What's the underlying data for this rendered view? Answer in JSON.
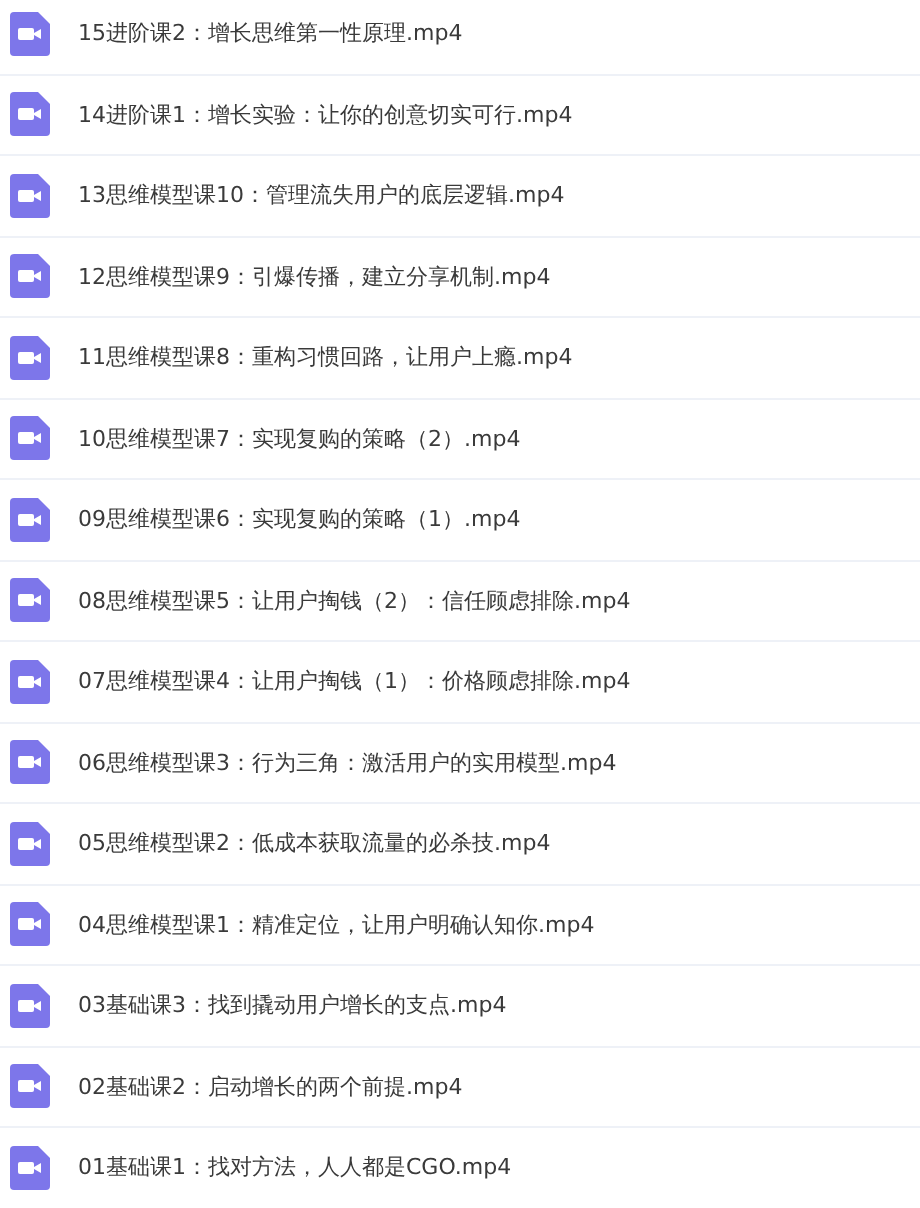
{
  "files": [
    {
      "name": "15进阶课2：增长思维第一性原理.mp4"
    },
    {
      "name": "14进阶课1：增长实验：让你的创意切实可行.mp4"
    },
    {
      "name": "13思维模型课10：管理流失用户的底层逻辑.mp4"
    },
    {
      "name": "12思维模型课9：引爆传播，建立分享机制.mp4"
    },
    {
      "name": "11思维模型课8：重构习惯回路，让用户上瘾.mp4"
    },
    {
      "name": "10思维模型课7：实现复购的策略（2）.mp4"
    },
    {
      "name": "09思维模型课6：实现复购的策略（1）.mp4"
    },
    {
      "name": "08思维模型课5：让用户掏钱（2）：信任顾虑排除.mp4"
    },
    {
      "name": "07思维模型课4：让用户掏钱（1）：价格顾虑排除.mp4"
    },
    {
      "name": "06思维模型课3：行为三角：激活用户的实用模型.mp4"
    },
    {
      "name": "05思维模型课2：低成本获取流量的必杀技.mp4"
    },
    {
      "name": "04思维模型课1：精准定位，让用户明确认知你.mp4"
    },
    {
      "name": "03基础课3：找到撬动用户增长的支点.mp4"
    },
    {
      "name": "02基础课2：启动增长的两个前提.mp4"
    },
    {
      "name": "01基础课1：找对方法，人人都是CGO.mp4"
    }
  ]
}
